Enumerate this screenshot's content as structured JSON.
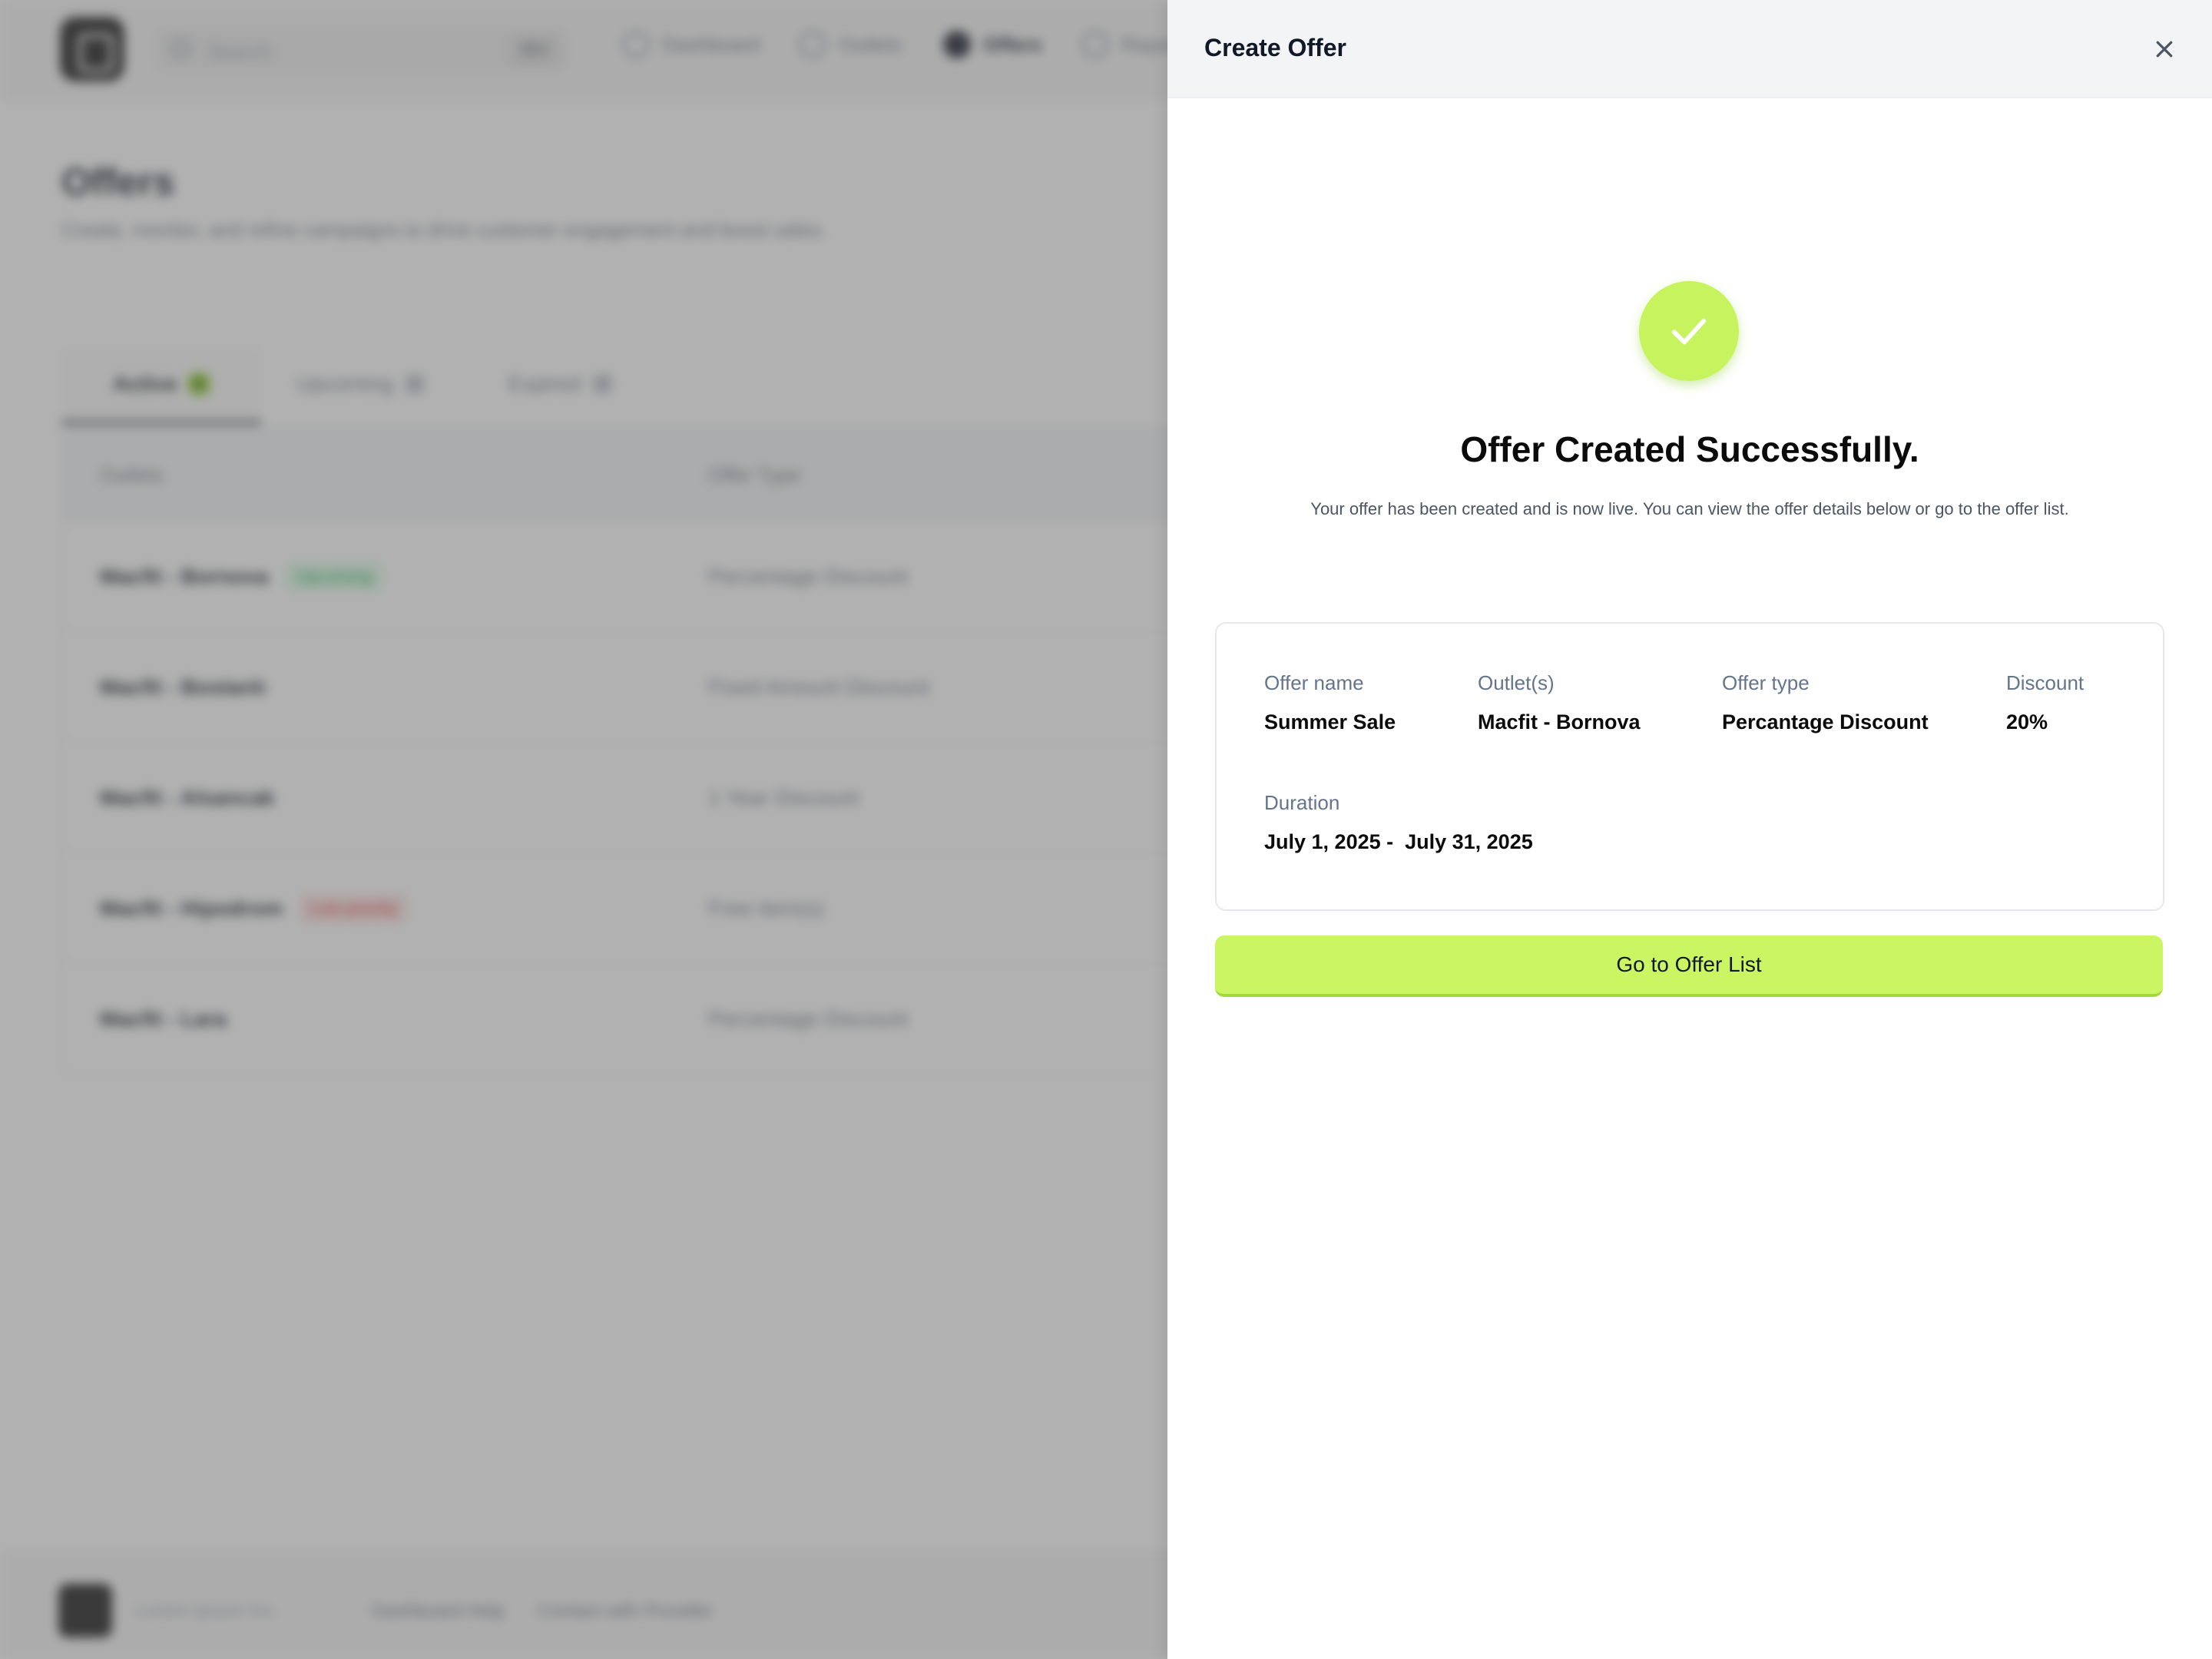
{
  "background": {
    "search": {
      "placeholder": "Search",
      "shortcut": "⌘K"
    },
    "nav": [
      {
        "label": "Dashboard"
      },
      {
        "label": "Outlets"
      },
      {
        "label": "Offers"
      },
      {
        "label": "Reports"
      }
    ],
    "page": {
      "title": "Offers",
      "subtitle": "Create, monitor, and refine campaigns to drive customer engagement and boost sales."
    },
    "tabs": [
      {
        "label": "Active",
        "count": "5"
      },
      {
        "label": "Upcoming",
        "count": "2"
      },
      {
        "label": "Expired",
        "count": "3"
      }
    ],
    "table": {
      "headers": [
        "Outlets",
        "Offer Type"
      ],
      "rows": [
        {
          "outlet": "Macfit - Bornova",
          "badge": "Upcoming",
          "type": "Percentage Discount"
        },
        {
          "outlet": "Macfit - Bostanlı",
          "badge": "",
          "type": "Fixed Amount Discount"
        },
        {
          "outlet": "Macfit - Alsancak",
          "badge": "",
          "type": "1 Year Discount"
        },
        {
          "outlet": "Macfit - Hipodrom",
          "badge": "Low priority",
          "type": "Free item(s)"
        },
        {
          "outlet": "Macfit - Lara",
          "badge": "",
          "type": "Percentage Discount"
        }
      ]
    },
    "footer": {
      "brand": "Lorem Ipsum Inc.",
      "links": [
        "Dashboard Help",
        "Contact with Provider"
      ]
    }
  },
  "drawer": {
    "title": "Create Offer",
    "success": {
      "title": "Offer Created Successfully.",
      "description": "Your offer has been created and is now live. You can view the offer details below or go to the offer list."
    },
    "details": {
      "offer_name": {
        "label": "Offer name",
        "value": "Summer Sale"
      },
      "outlets": {
        "label": "Outlet(s)",
        "value": "Macfit - Bornova"
      },
      "offer_type": {
        "label": "Offer type",
        "value": "Percantage Discount"
      },
      "discount": {
        "label": "Discount",
        "value": "20%"
      },
      "duration": {
        "label": "Duration",
        "value": "July 1, 2025 -  July 31, 2025"
      }
    },
    "primary_button": "Go to Offer List"
  },
  "colors": {
    "accent": "#cbf562",
    "success_icon": "#c7f35f",
    "overlay": "rgba(100,100,100,0.5)",
    "label": "#64748b"
  },
  "icons": {
    "close": "close-icon",
    "success": "checkmark-icon",
    "search": "search-icon"
  }
}
